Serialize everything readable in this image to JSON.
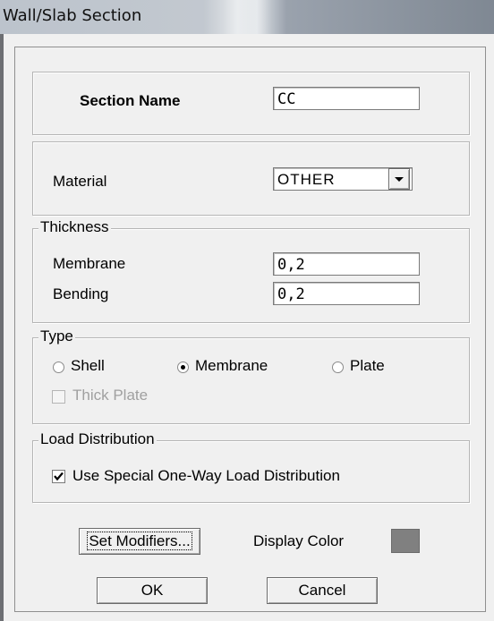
{
  "window": {
    "title": "Wall/Slab Section"
  },
  "section_name": {
    "label": "Section Name",
    "value": "CC"
  },
  "material": {
    "label": "Material",
    "selected": "OTHER"
  },
  "thickness": {
    "legend": "Thickness",
    "membrane_label": "Membrane",
    "membrane_value": "0,2",
    "bending_label": "Bending",
    "bending_value": "0,2"
  },
  "type": {
    "legend": "Type",
    "options": [
      "Shell",
      "Membrane",
      "Plate"
    ],
    "selected": "Membrane",
    "thick_plate_label": "Thick Plate",
    "thick_plate_checked": false
  },
  "load_distribution": {
    "legend": "Load Distribution",
    "special_one_way_label": "Use Special One-Way Load Distribution",
    "special_one_way_checked": true
  },
  "buttons": {
    "set_modifiers": "Set Modifiers...",
    "display_color_label": "Display Color",
    "display_color": "#808080",
    "ok": "OK",
    "cancel": "Cancel"
  }
}
